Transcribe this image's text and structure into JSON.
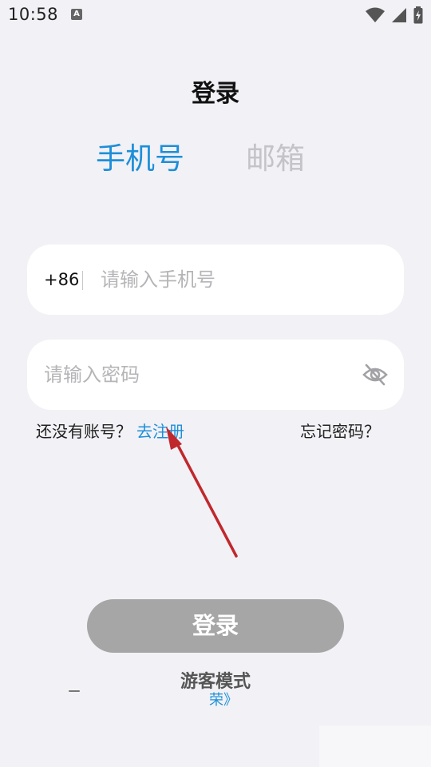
{
  "status_bar": {
    "time": "10:58",
    "notification_glyph": "A",
    "icons": [
      "wifi-icon",
      "cellular-signal-icon",
      "battery-charging-icon"
    ]
  },
  "header": {
    "title": "登录"
  },
  "tabs": [
    {
      "label": "手机号",
      "active": true
    },
    {
      "label": "邮箱",
      "active": false
    }
  ],
  "phone_field": {
    "country_code": "+86",
    "placeholder": "请输入手机号",
    "value": ""
  },
  "password_field": {
    "placeholder": "请输入密码",
    "value": "",
    "toggle_icon": "eye-off-icon"
  },
  "links": {
    "no_account": "还没有账号？",
    "register": "去注册",
    "forgot_password": "忘记密码？"
  },
  "login_button": {
    "label": "登录"
  },
  "guest_mode": {
    "label": "游客模式"
  },
  "agreement_fragment": "荣》",
  "colors": {
    "accent": "#1d8fd8",
    "inactive_tab": "#c4c4c8",
    "background": "#f1f1f6",
    "button_disabled": "#a6a6a6",
    "annotation_arrow": "#c0282d"
  }
}
